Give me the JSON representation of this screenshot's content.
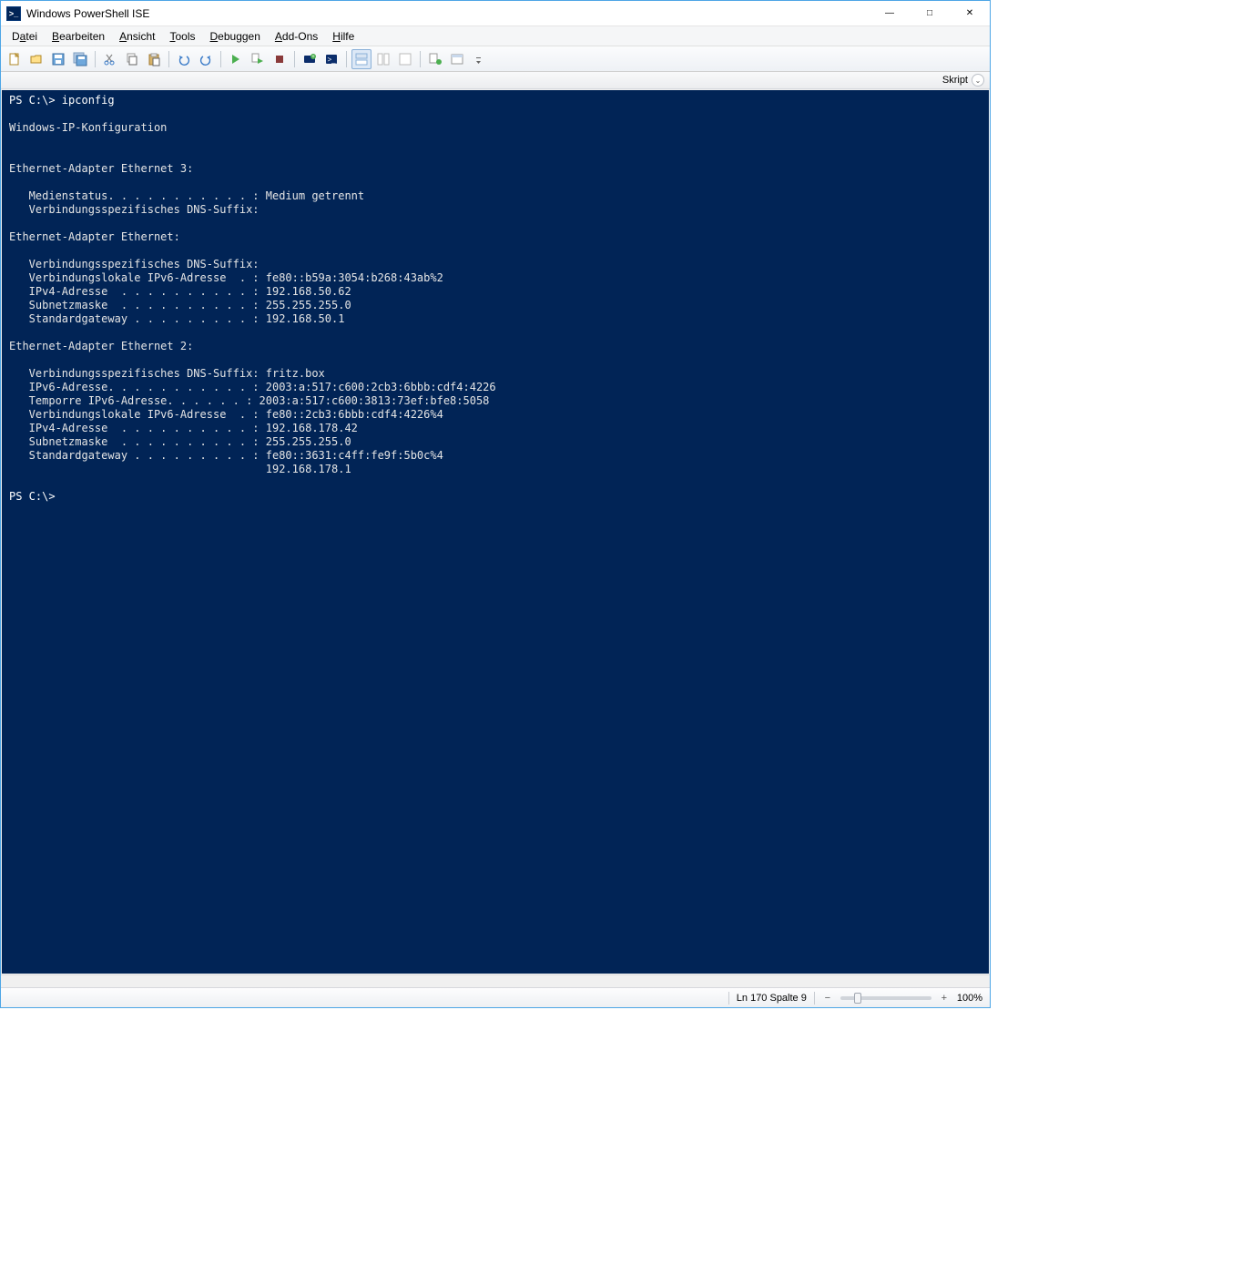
{
  "titlebar": {
    "title": "Windows PowerShell ISE"
  },
  "menubar": {
    "items": [
      {
        "prefix": "D",
        "ul": "a",
        "rest": "tei"
      },
      {
        "prefix": "",
        "ul": "B",
        "rest": "earbeiten"
      },
      {
        "prefix": "",
        "ul": "A",
        "rest": "nsicht"
      },
      {
        "prefix": "",
        "ul": "T",
        "rest": "ools"
      },
      {
        "prefix": "",
        "ul": "D",
        "rest": "ebuggen"
      },
      {
        "prefix": "",
        "ul": "A",
        "rest": "dd-Ons"
      },
      {
        "prefix": "",
        "ul": "H",
        "rest": "ilfe"
      }
    ]
  },
  "scriptbar": {
    "label": "Skript"
  },
  "console": {
    "prompt1": "PS C:\\> ",
    "cmd1": "ipconfig",
    "output": "\nWindows-IP-Konfiguration\n\n\nEthernet-Adapter Ethernet 3:\n\n   Medienstatus. . . . . . . . . . . : Medium getrennt\n   Verbindungsspezifisches DNS-Suffix:\n\nEthernet-Adapter Ethernet:\n\n   Verbindungsspezifisches DNS-Suffix:\n   Verbindungslokale IPv6-Adresse  . : fe80::b59a:3054:b268:43ab%2\n   IPv4-Adresse  . . . . . . . . . . : 192.168.50.62\n   Subnetzmaske  . . . . . . . . . . : 255.255.255.0\n   Standardgateway . . . . . . . . . : 192.168.50.1\n\nEthernet-Adapter Ethernet 2:\n\n   Verbindungsspezifisches DNS-Suffix: fritz.box\n   IPv6-Adresse. . . . . . . . . . . : 2003:a:517:c600:2cb3:6bbb:cdf4:4226\n   Tempor‎re IPv6-Adresse. . . . . . : 2003:a:517:c600:3813:73ef:bfe8:5058\n   Verbindungslokale IPv6-Adresse  . : fe80::2cb3:6bbb:cdf4:4226%4\n   IPv4-Adresse  . . . . . . . . . . : 192.168.178.42\n   Subnetzmaske  . . . . . . . . . . : 255.255.255.0\n   Standardgateway . . . . . . . . . : fe80::3631:c4ff:fe9f:5b0c%4\n                                       192.168.178.1\n",
    "prompt2": "PS C:\\> "
  },
  "statusbar": {
    "position": "Ln 170  Spalte 9",
    "zoom": "100%"
  }
}
